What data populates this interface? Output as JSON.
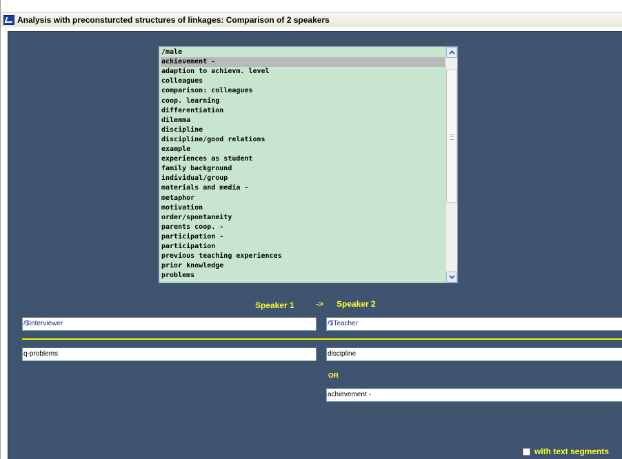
{
  "window": {
    "title": "Analysis with preconsturcted structures of linkages: Comparison of 2 speakers"
  },
  "list": {
    "items": [
      "/male",
      "achievement -",
      "adaption to achievm. level",
      "colleagues",
      "comparison: colleagues",
      "coop. learning",
      "differentiation",
      "dilemma",
      "discipline",
      "discipline/good relations",
      "example",
      "experiences as student",
      "family background",
      "individual/group",
      "materials and media -",
      "metaphor",
      "motivation",
      "order/spontaneity",
      "parents coop. -",
      "participation -",
      "participation",
      "previous teaching experiences",
      "prior knowledge",
      "problems"
    ],
    "selected_index": 1
  },
  "labels": {
    "speaker1": "Speaker 1",
    "arrow": "->",
    "speaker2": "Speaker 2",
    "or": "OR",
    "with_text_segments": "with text segments"
  },
  "fields": {
    "speaker1_name": "/$Interviewer",
    "speaker2_name": "/$Teacher",
    "speaker1_code": "q-problems",
    "speaker2_code": "discipline",
    "speaker2_alt_code": "achievement -"
  },
  "checkbox": {
    "checked": false
  },
  "icons": {
    "app": "app-icon",
    "scroll_up": "chevron-up-icon",
    "scroll_down": "chevron-down-icon"
  }
}
